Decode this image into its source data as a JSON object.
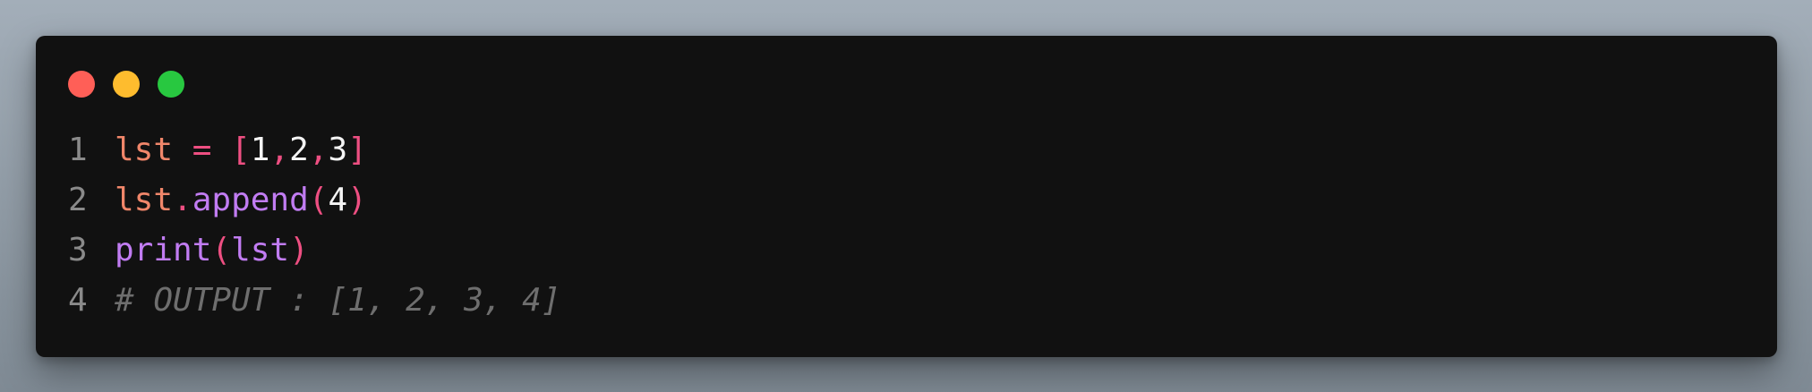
{
  "window": {
    "controls": [
      {
        "name": "close",
        "color": "#ff5f57"
      },
      {
        "name": "minimize",
        "color": "#febc2e"
      },
      {
        "name": "maximize",
        "color": "#28c840"
      }
    ]
  },
  "code": {
    "lines": [
      {
        "number": "1",
        "tokens": [
          {
            "text": "lst",
            "type": "var"
          },
          {
            "text": " ",
            "type": "ws"
          },
          {
            "text": "=",
            "type": "op"
          },
          {
            "text": " ",
            "type": "ws"
          },
          {
            "text": "[",
            "type": "op"
          },
          {
            "text": "1",
            "type": "num"
          },
          {
            "text": ",",
            "type": "op"
          },
          {
            "text": "2",
            "type": "num"
          },
          {
            "text": ",",
            "type": "op"
          },
          {
            "text": "3",
            "type": "num"
          },
          {
            "text": "]",
            "type": "op"
          }
        ]
      },
      {
        "number": "2",
        "tokens": [
          {
            "text": "lst",
            "type": "var"
          },
          {
            "text": ".",
            "type": "op"
          },
          {
            "text": "append",
            "type": "func"
          },
          {
            "text": "(",
            "type": "op"
          },
          {
            "text": "4",
            "type": "num"
          },
          {
            "text": ")",
            "type": "op"
          }
        ]
      },
      {
        "number": "3",
        "tokens": [
          {
            "text": "print",
            "type": "func"
          },
          {
            "text": "(",
            "type": "op"
          },
          {
            "text": "lst",
            "type": "func"
          },
          {
            "text": ")",
            "type": "op"
          }
        ]
      },
      {
        "number": "4",
        "tokens": [
          {
            "text": "# OUTPUT : [1, 2, 3, 4]",
            "type": "comment"
          }
        ]
      }
    ]
  }
}
